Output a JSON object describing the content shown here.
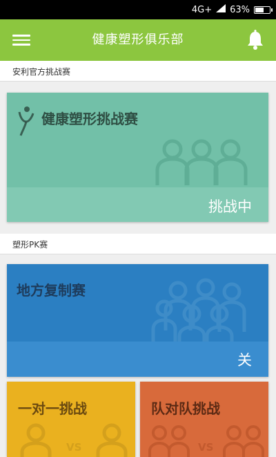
{
  "status_bar": {
    "network": "4G+",
    "battery_text": "63%",
    "battery_level": 0.63
  },
  "app_bar": {
    "title": "健康塑形俱乐部",
    "menu_icon": "hamburger-menu-icon",
    "bell_icon": "bell-icon"
  },
  "colors": {
    "app_bar": "#8cc63f",
    "official_card": "#72c0a8",
    "official_footer": "#82c9b3",
    "local_card": "#2b7fc2",
    "local_footer": "#3a8dcf",
    "one_vs_one_card": "#eab11f",
    "team_card": "#d86a3b"
  },
  "sections": [
    {
      "title": "安利官方挑战赛",
      "cards": [
        {
          "title": "健康塑形挑战赛",
          "status": "挑战中",
          "icon": "running-figure-icon",
          "decoration": "people-group-icon"
        }
      ]
    },
    {
      "title": "塑形PK赛",
      "cards": [
        {
          "title": "地方复制赛",
          "status": "关",
          "decoration": "crowd-icon"
        },
        {
          "title": "一对一挑战",
          "vs": "VS",
          "decoration": "one-vs-one-icon"
        },
        {
          "title": "队对队挑战",
          "vs": "VS",
          "decoration": "team-vs-team-icon"
        }
      ]
    }
  ]
}
